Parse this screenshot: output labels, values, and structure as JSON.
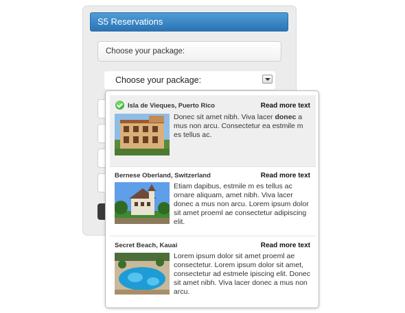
{
  "widget": {
    "title": "S5 Reservations",
    "package_box_label": "Choose your package:"
  },
  "select": {
    "label": "Choose your package:"
  },
  "options": [
    {
      "title": "Isla de Vieques, Puerto Rico",
      "read_more": "Read more text",
      "desc_prefix": "Donec sit amet nibh. Viva lacer ",
      "desc_bold": "donec",
      "desc_suffix": " a mus non arcu. Consectetur ea estmile m es tellus ac.",
      "selected": true
    },
    {
      "title": "Bernese Oberland, Switzerland",
      "read_more": "Read more text",
      "desc": "Etiam dapibus, estmile m es tellus ac ornare aliquam, amet nibh. Viva lacer donec a mus non arcu. Lorem ipsum dolor sit amet proeml ae consectetur adipiscing elit."
    },
    {
      "title": "Secret Beach, Kauai",
      "read_more": "Read more text",
      "desc": "Lorem ipsum dolor sit amet proeml ae consectetur. Lorem ipsum dolor sit amet, consectetur ad estmele ipiscing elit. Donec sit amet nibh. Viva lacer donec a mus non arcu."
    }
  ],
  "colors": {
    "title_bar": "#2b73b5",
    "check": "#2b9a27"
  },
  "icons": {
    "selected_check": "check-circle-icon",
    "dropdown_arrow": "chevron-down-icon"
  }
}
